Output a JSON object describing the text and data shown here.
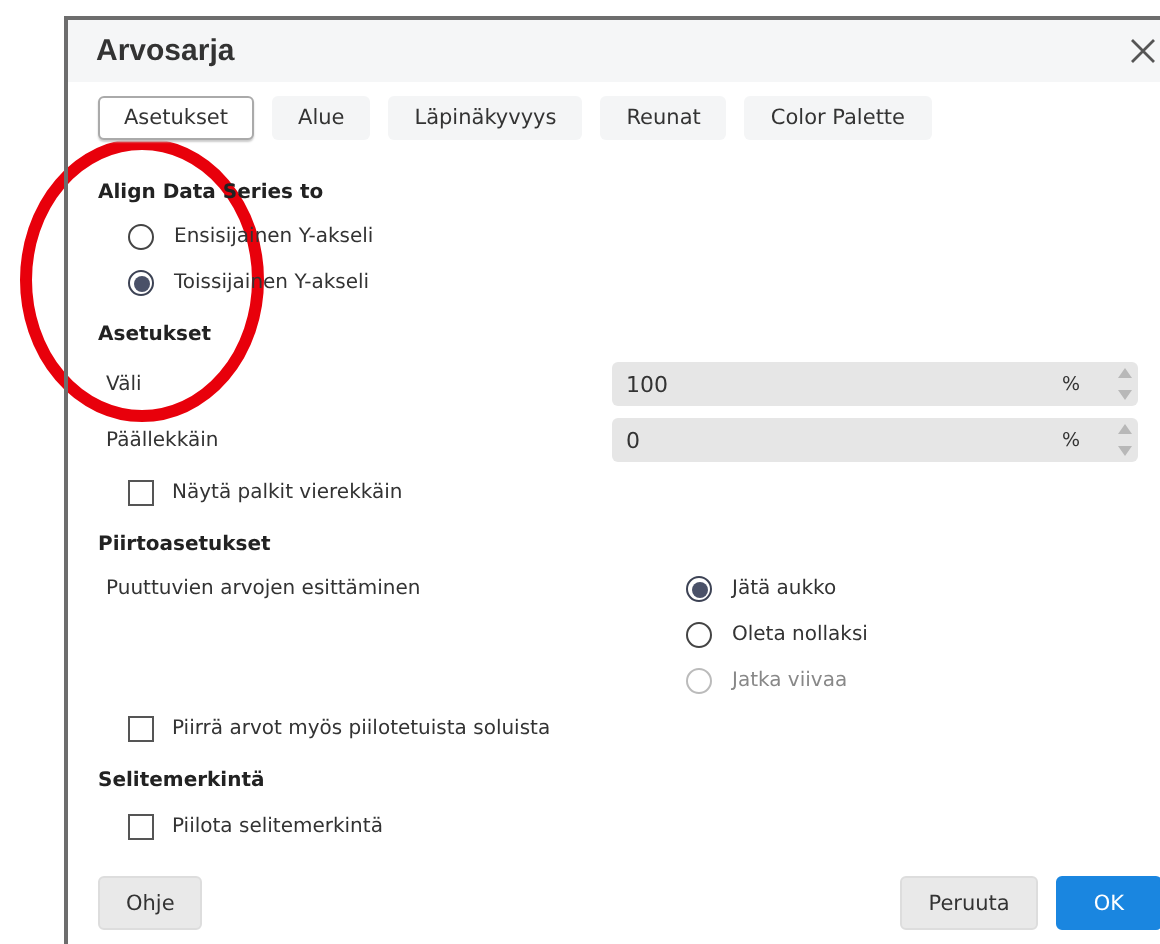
{
  "dialog": {
    "title": "Arvosarja"
  },
  "tabs": [
    {
      "label": "Asetukset",
      "selected": true
    },
    {
      "label": "Alue",
      "selected": false
    },
    {
      "label": "Läpinäkyvyys",
      "selected": false
    },
    {
      "label": "Reunat",
      "selected": false
    },
    {
      "label": "Color Palette",
      "selected": false
    }
  ],
  "sections": [
    {
      "heading": "Align Data Series to",
      "items": [
        {
          "kind": "radio",
          "label": "Ensisijainen Y-akseli",
          "selected": false,
          "disabled": false
        },
        {
          "kind": "radio",
          "label": "Toissijainen Y-akseli",
          "selected": true,
          "disabled": false
        }
      ]
    },
    {
      "heading": "Asetukset",
      "items": [
        {
          "kind": "spin",
          "label": "Väli",
          "value": "100",
          "unit": "%"
        },
        {
          "kind": "spin",
          "label": "Päällekkäin",
          "value": "0",
          "unit": "%"
        },
        {
          "kind": "checkbox",
          "label": "Näytä palkit vierekkäin",
          "checked": false
        }
      ]
    },
    {
      "heading": "Piirtoasetukset",
      "items": [
        {
          "kind": "radiogroup",
          "label": "Puuttuvien arvojen esittäminen",
          "options": [
            {
              "label": "Jätä aukko",
              "selected": true,
              "disabled": false
            },
            {
              "label": "Oleta nollaksi",
              "selected": false,
              "disabled": false
            },
            {
              "label": "Jatka viivaa",
              "selected": false,
              "disabled": true
            }
          ]
        },
        {
          "kind": "checkbox",
          "label": "Piirrä arvot myös piilotetuista soluista",
          "checked": false
        }
      ]
    },
    {
      "heading": "Selitemerkintä",
      "items": [
        {
          "kind": "checkbox",
          "label": "Piilota selitemerkintä",
          "checked": false
        }
      ]
    }
  ],
  "buttons": [
    {
      "kind": "help",
      "label": "Ohje"
    },
    {
      "kind": "cancel",
      "label": "Peruuta"
    },
    {
      "kind": "primary",
      "label": "OK"
    }
  ],
  "annotations": [
    {
      "kind": "circle"
    }
  ]
}
